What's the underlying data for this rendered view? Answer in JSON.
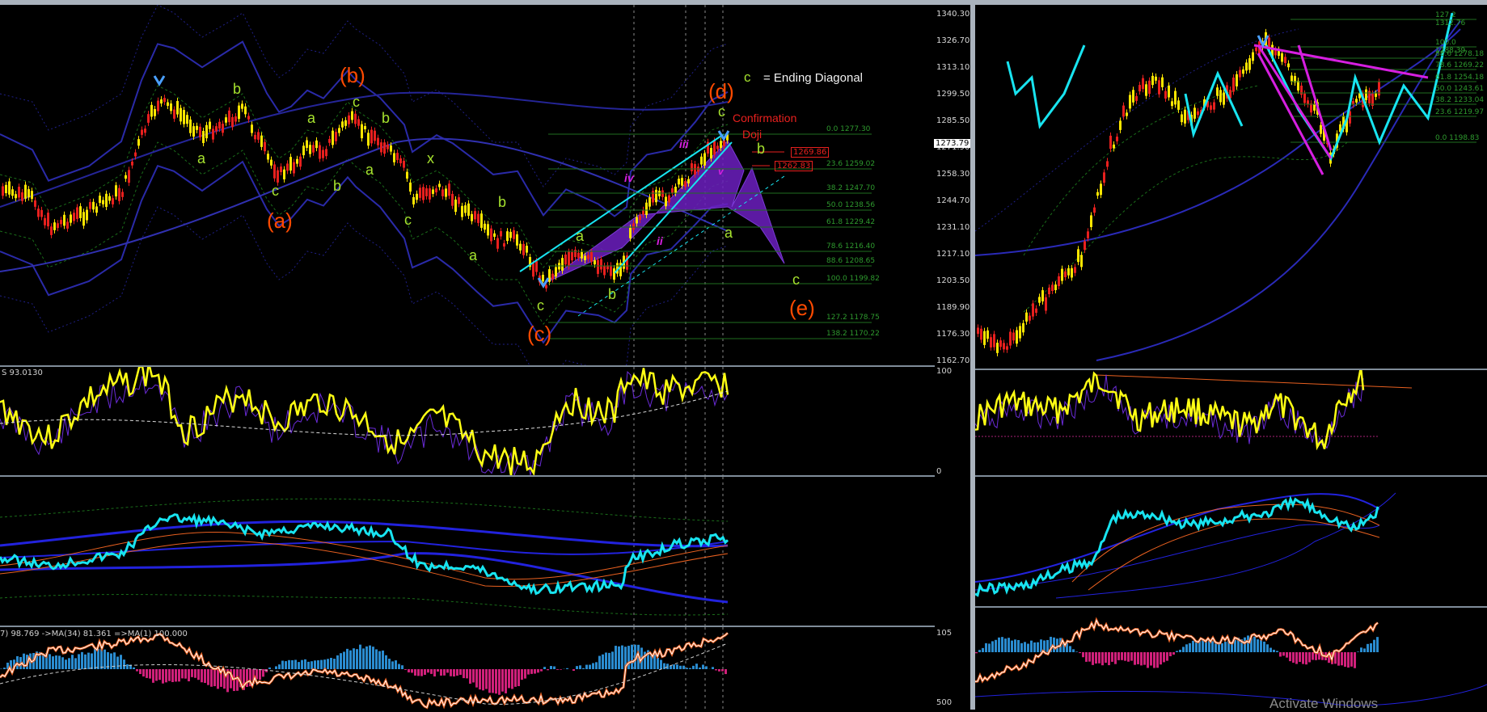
{
  "left_chart": {
    "price_axis": [
      "1340.30",
      "1326.70",
      "1313.10",
      "1299.50",
      "1285.50",
      "1271.90",
      "1258.30",
      "1244.70",
      "1231.10",
      "1217.10",
      "1203.50",
      "1189.90",
      "1176.30",
      "1162.70"
    ],
    "current_price": "1273.79",
    "wave_labels": {
      "a_paren": "(a)",
      "b_paren": "(b)",
      "c_paren": "(c)",
      "d_paren": "(d)",
      "e_paren": "(e)",
      "a": "a",
      "b": "b",
      "c": "c",
      "x": "x",
      "iii": "iii",
      "iv": "iv",
      "ii": "ii",
      "v": "v"
    },
    "legend_c": "c",
    "legend_text": "= Ending Diagonal",
    "confirmation": "Confirmation",
    "doji": "Doji",
    "price_boxes": [
      "1269.86",
      "1262.83"
    ],
    "fib_levels": [
      "0.0 1277.30",
      "23.6 1259.02",
      "38.2 1247.70",
      "50.0 1238.56",
      "61.8 1229.42",
      "78.6 1216.40",
      "88.6 1208.65",
      "100.0 1199.82",
      "127.2 1178.75",
      "138.2 1170.22"
    ]
  },
  "left_osc": {
    "label": "S 93.0130",
    "scale_top": "100",
    "scale_bottom": "0"
  },
  "left_bottom": {
    "label": "7) 98.769  ->MA(34) 81.361  =>MA(1) 100.000",
    "scale_top": "105",
    "scale_bottom": "500"
  },
  "right_chart": {
    "fib_levels": [
      "127.2 1312.76",
      "100.0 1288.39",
      "88.6 1278.18",
      "78.6 1269.22",
      "61.8 1254.18",
      "50.0 1243.61",
      "38.2 1233.04",
      "23.6 1219.97",
      "0.0 1198.83"
    ]
  },
  "watermark": "Activate Windows",
  "colors": {
    "candle_up": "#ffe600",
    "candle_down": "#e8201e",
    "wave_orange": "#ff4a00",
    "wave_green": "#a6e22e",
    "fib_green": "#1f6e1f",
    "cyan": "#18e4f0",
    "purple": "#6c1fbf",
    "magenta": "#d61fe0",
    "band_blue": "#2a2aa8",
    "osc_yellow": "#ffff14"
  }
}
